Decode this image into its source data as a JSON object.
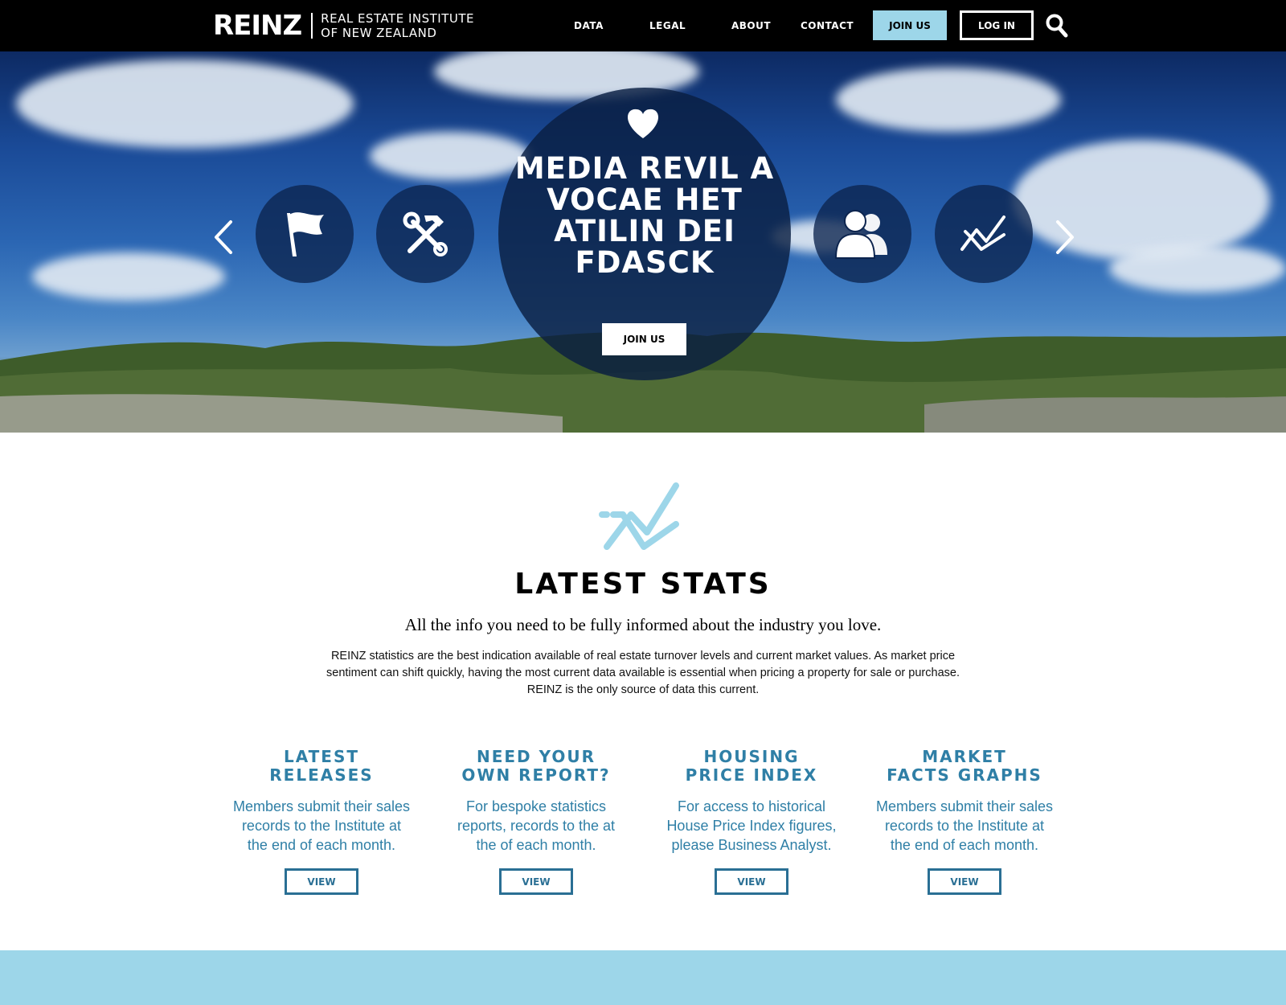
{
  "header": {
    "logo_mark": "REINZ",
    "logo_line1": "REAL ESTATE INSTITUTE",
    "logo_line2": "OF NEW ZEALAND",
    "nav": [
      "DATA",
      "LEGAL",
      "ABOUT",
      "CONTACT"
    ],
    "join_label": "JOIN US",
    "login_label": "LOG IN",
    "search_icon": "search-icon"
  },
  "hero": {
    "title": "MEDIA REVIL A VOCAE HET ATILIN DEI FDASCK",
    "join_label": "JOIN US",
    "icons": [
      "flag-icon",
      "tools-icon",
      "heart-icon",
      "users-icon",
      "stats-icon"
    ],
    "prev_icon": "chevron-left-icon",
    "next_icon": "chevron-right-icon"
  },
  "stats": {
    "title": "LATEST STATS",
    "subtitle": "All the info you need to be fully informed about the industry you love.",
    "body": "REINZ statistics are the best indication available of real estate turnover levels and current market values.  As market price sentiment can shift quickly, having the most current data available is essential when pricing a property for sale or purchase.  REINZ is the only source of data this current.",
    "columns": [
      {
        "title": "LATEST\nRELEASES",
        "text": "Members submit their sales records to the Institute at the end of each month.",
        "button": "VIEW"
      },
      {
        "title": "NEED YOUR\nOWN REPORT?",
        "text": "For bespoke statistics reports, records to the at the of each month.",
        "button": "VIEW"
      },
      {
        "title": "HOUSING\nPRICE INDEX",
        "text": "For access to historical House Price Index figures, please Business Analyst.",
        "button": "VIEW"
      },
      {
        "title": "MARKET\nFACTS GRAPHS",
        "text": "Members submit their sales records to the Institute at the end of each month.",
        "button": "VIEW"
      }
    ]
  },
  "colors": {
    "header_bg": "#000000",
    "accent_light_blue": "#9dd6e9",
    "text_blue": "#2f7fa6",
    "button_blue": "#2a6f94"
  }
}
